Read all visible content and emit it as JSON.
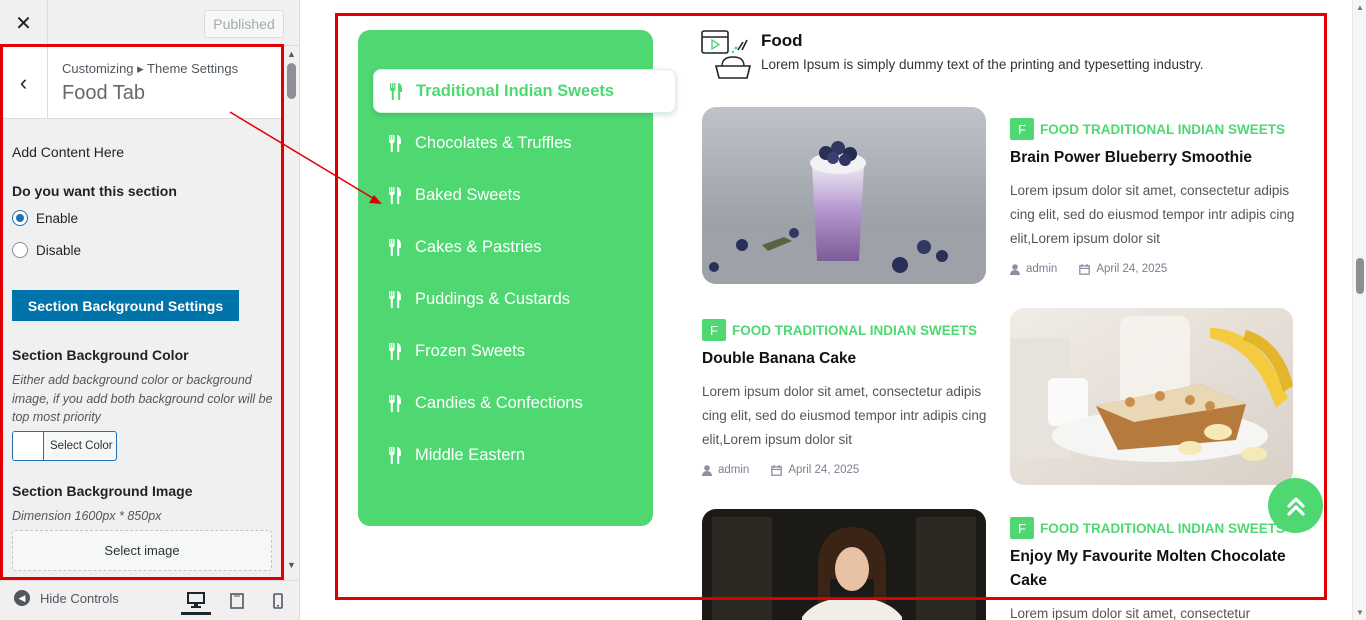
{
  "customizer": {
    "close_icon": "close-icon",
    "publish_label": "Published",
    "breadcrumb": "Customizing ▸ Theme Settings",
    "section_title": "Food Tab",
    "add_content_label": "Add Content Here",
    "section_question": "Do you want this section",
    "radio_enable": "Enable",
    "radio_disable": "Disable",
    "radio_selected": "Enable",
    "bg_settings_button": "Section Background Settings",
    "bg_color_title": "Section Background Color",
    "bg_color_desc": "Either add background color or background image, if you add both background color will be top most priority",
    "select_color_button": "Select Color",
    "bg_image_title": "Section Background Image",
    "bg_image_dimension": "Dimension 1600px * 850px",
    "select_image_button": "Select image",
    "hide_controls": "Hide Controls",
    "device_icons": [
      "desktop-icon",
      "tablet-icon",
      "mobile-icon"
    ],
    "active_device": "desktop"
  },
  "preview": {
    "accent_color": "#4fd872",
    "tabs": [
      {
        "label": "Traditional Indian Sweets",
        "active": true
      },
      {
        "label": "Chocolates & Truffles",
        "active": false
      },
      {
        "label": "Baked Sweets",
        "active": false
      },
      {
        "label": "Cakes & Pastries",
        "active": false
      },
      {
        "label": "Puddings & Custards",
        "active": false
      },
      {
        "label": "Frozen Sweets",
        "active": false
      },
      {
        "label": "Candies & Confections",
        "active": false
      },
      {
        "label": "Middle Eastern",
        "active": false
      }
    ],
    "heading": {
      "title": "Food",
      "subtitle": "Lorem Ipsum is simply dummy text of the printing and typesetting industry."
    },
    "posts": [
      {
        "badge": "F",
        "category": "FOOD TRADITIONAL INDIAN SWEETS",
        "title": "Brain Power Blueberry Smoothie",
        "excerpt": "Lorem ipsum dolor sit amet, consectetur adipis cing elit, sed do eiusmod tempor intr adipis cing elit,Lorem ipsum dolor sit",
        "author": "admin",
        "date": "April 24, 2025",
        "image": "blueberry-smoothie-photo"
      },
      {
        "badge": "F",
        "category": "FOOD TRADITIONAL INDIAN SWEETS",
        "title": "Double Banana Cake",
        "excerpt": "Lorem ipsum dolor sit amet, consectetur adipis cing elit, sed do eiusmod tempor intr adipis cing elit,Lorem ipsum dolor sit",
        "author": "admin",
        "date": "April 24, 2025",
        "image": "banana-cake-photo"
      },
      {
        "badge": "F",
        "category": "FOOD TRADITIONAL INDIAN SWEETS",
        "title": "Enjoy My Favourite Molten Chocolate Cake",
        "excerpt": "Lorem ipsum dolor sit amet, consectetur",
        "image": "girl-cooking-photo"
      }
    ]
  }
}
